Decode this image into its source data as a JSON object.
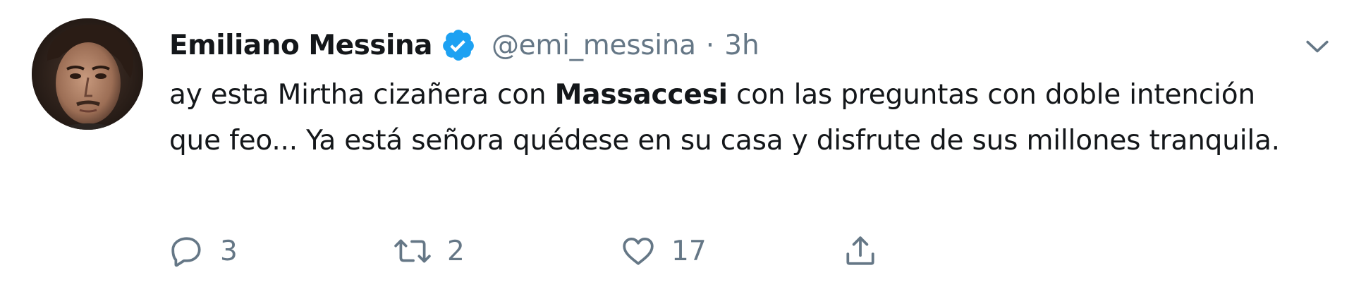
{
  "tweet": {
    "display_name": "Emiliano Messina",
    "handle": "@emi_messina",
    "separator": "·",
    "time": "3h",
    "text_before": "ay esta Mirtha cizañera con ",
    "mention": "Massaccesi",
    "text_after": " con las preguntas con doble intención que feo... Ya está señora quédese en su casa y disfrute de sus millones tranquila."
  },
  "actions": {
    "reply_count": "3",
    "retweet_count": "2",
    "like_count": "17"
  },
  "icons": {
    "verified": "verified-badge-icon",
    "caret": "chevron-down-icon",
    "reply": "reply-icon",
    "retweet": "retweet-icon",
    "like": "heart-icon",
    "share": "share-icon"
  },
  "colors": {
    "verified_blue": "#1da1f2",
    "text": "#14171a",
    "secondary": "#657786"
  }
}
